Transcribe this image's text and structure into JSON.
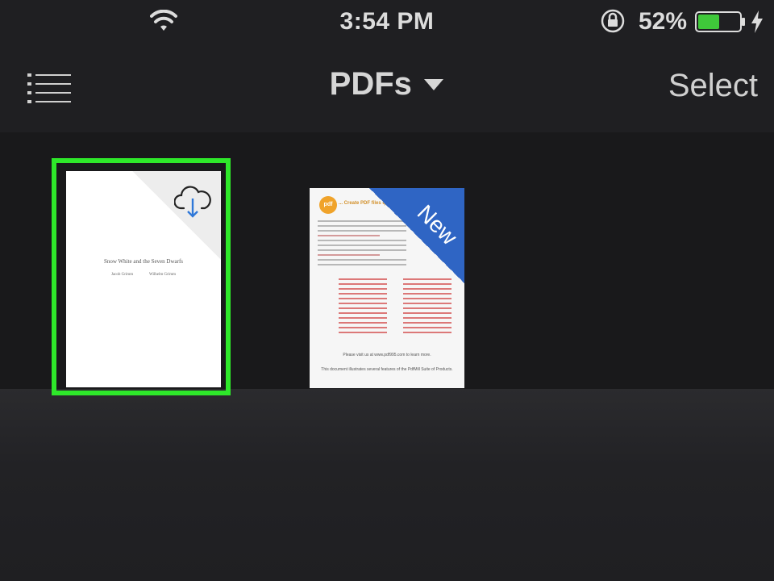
{
  "status_bar": {
    "time": "3:54 PM",
    "battery_percent": "52%",
    "battery_level": 0.52,
    "battery_color": "#3fc83a",
    "icons": [
      "wifi-icon",
      "orientation-lock-icon",
      "battery-icon",
      "charging-bolt-icon"
    ]
  },
  "nav": {
    "title": "PDFs",
    "select_label": "Select",
    "menu_icon": "list-icon",
    "dropdown_icon": "caret-down-icon"
  },
  "documents": [
    {
      "title": "Snow White and the Seven Dwarfs",
      "authors": [
        "Jacob Grimm",
        "Wilhelm Grimm"
      ],
      "badge_icon": "cloud-download-icon",
      "selected": true,
      "highlight_color": "#2ee82a"
    },
    {
      "badge": "New",
      "badge_color": "#2f65c4",
      "logo": "pdf",
      "header": "... Create PDF files q",
      "footer_line1": "Please visit us at www.pdf995.com to learn more.",
      "footer_line2": "This document illustrates several features of the PdfMill Suite of Products."
    }
  ]
}
